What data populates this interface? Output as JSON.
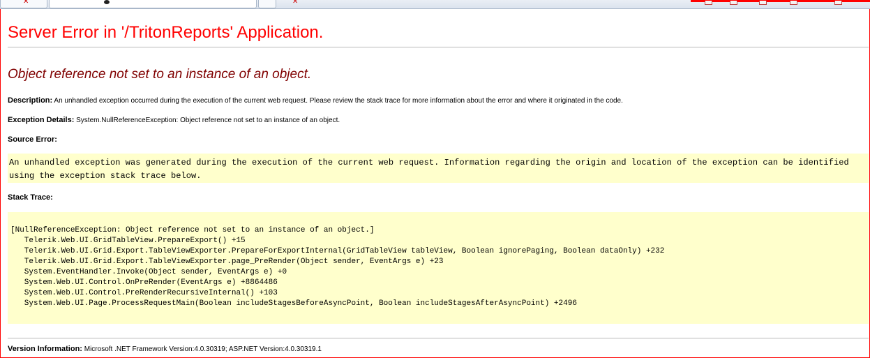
{
  "page": {
    "title": "Server Error in '/TritonReports' Application.",
    "error_message": "Object reference not set to an instance of an object.",
    "description": {
      "label": "Description:",
      "text": "An unhandled exception occurred during the execution of the current web request. Please review the stack trace for more information about the error and where it originated in the code."
    },
    "exception_details": {
      "label": "Exception Details:",
      "text": "System.NullReferenceException: Object reference not set to an instance of an object."
    },
    "source_error": {
      "label": "Source Error:",
      "text": "An unhandled exception was generated during the execution of the current web request. Information regarding the origin and location of the exception can be identified using the exception stack trace below."
    },
    "stack_trace": {
      "label": "Stack Trace:",
      "lines": [
        "[NullReferenceException: Object reference not set to an instance of an object.]",
        "   Telerik.Web.UI.GridTableView.PrepareExport() +15",
        "   Telerik.Web.UI.Grid.Export.TableViewExporter.PrepareForExportInternal(GridTableView tableView, Boolean ignorePaging, Boolean dataOnly) +232",
        "   Telerik.Web.UI.Grid.Export.TableViewExporter.page_PreRender(Object sender, EventArgs e) +23",
        "   System.EventHandler.Invoke(Object sender, EventArgs e) +0",
        "   System.Web.UI.Control.OnPreRender(EventArgs e) +8864486",
        "   System.Web.UI.Control.PreRenderRecursiveInternal() +103",
        "   System.Web.UI.Page.ProcessRequestMain(Boolean includeStagesBeforeAsyncPoint, Boolean includeStagesAfterAsyncPoint) +2496"
      ]
    },
    "version_info": {
      "label": "Version Information:",
      "text": "Microsoft .NET Framework Version:4.0.30319; ASP.NET Version:4.0.30319.1"
    }
  },
  "colors": {
    "title": "#ff0000",
    "error_message": "#800000",
    "code_background": "#ffffcc",
    "annotation_border": "#ff0000"
  },
  "icons": {
    "tab_favicon": "favicon-icon",
    "tab_close": "close-icon"
  }
}
